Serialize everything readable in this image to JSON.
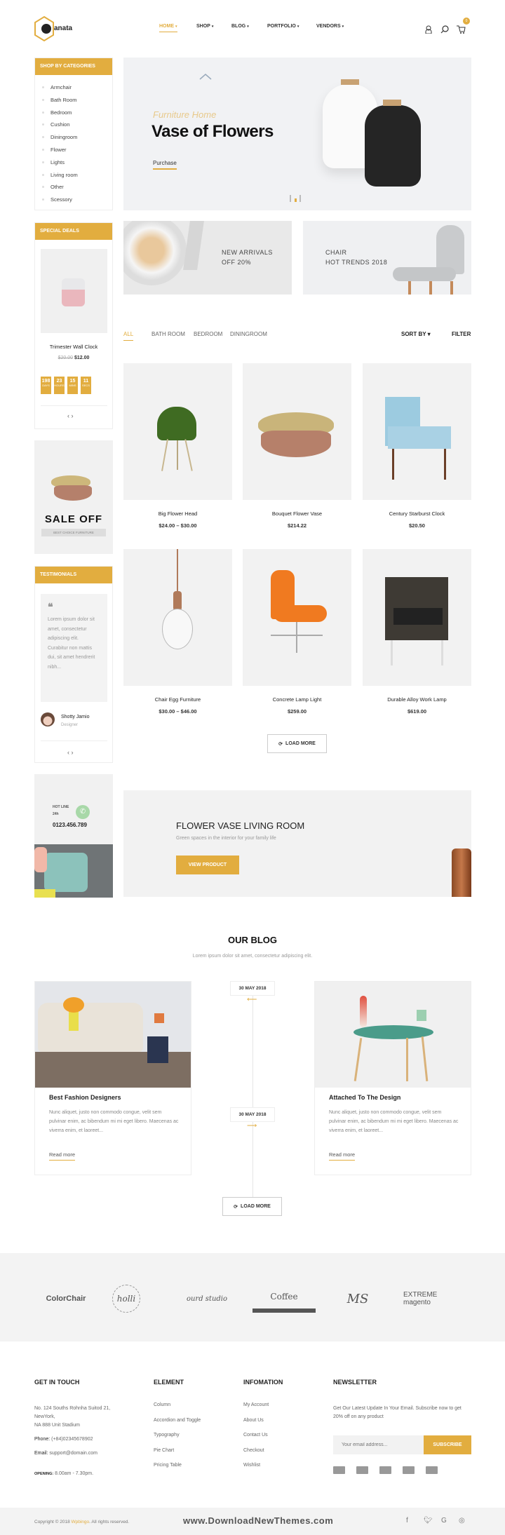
{
  "header": {
    "logo_text": "anata",
    "nav": [
      {
        "label": "HOME",
        "active": true
      },
      {
        "label": "SHOP"
      },
      {
        "label": "BLOG"
      },
      {
        "label": "PORTFOLIO"
      },
      {
        "label": "VENDORS"
      }
    ],
    "cart_count": "0",
    "icons": [
      "user-icon",
      "search-icon",
      "cart-icon"
    ]
  },
  "sidebar": {
    "categories_title": "SHOP BY CATEGORIES",
    "categories": [
      "Armchair",
      "Bath Room",
      "Bedroom",
      "Cushion",
      "Diningroom",
      "Flower",
      "Lights",
      "Living room",
      "Other",
      "Scessory"
    ],
    "special_title": "SPECIAL DEALS",
    "special": {
      "name": "Trimester Wall Clock",
      "old_price": "$20.00",
      "price": "$12.00",
      "countdown": [
        {
          "value": "198",
          "unit": "DAYS"
        },
        {
          "value": "23",
          "unit": "HOURS"
        },
        {
          "value": "15",
          "unit": "MINS"
        },
        {
          "value": "11",
          "unit": "SECS"
        }
      ]
    },
    "sale": {
      "title": "SALE OFF",
      "tag": "BEST CHOICE FURNITURE"
    },
    "testimonials_title": "TESTIMONIALS",
    "testimonial": {
      "text": "Lorem ipsum dolor sit amet, consectetur adipiscing elit. Curabitur non mattis dui, sit amet hendrerit nibh...",
      "name": "Shotty Jamio",
      "role": "Designer"
    },
    "hotline": {
      "label": "HOT LINE 24h",
      "phone": "0123.456.789"
    }
  },
  "hero": {
    "kicker": "Furniture Home",
    "title": "Vase of Flowers",
    "cta": "Purchase",
    "slides": 3,
    "active_slide": 2
  },
  "banners": [
    {
      "line1": "NEW ARRIVALS",
      "line2": "OFF 20%"
    },
    {
      "line1": "CHAIR",
      "line2": "HOT TRENDS 2018"
    }
  ],
  "filter": {
    "tabs": [
      "ALL",
      "BATH ROOM",
      "BEDROOM",
      "DININGROOM"
    ],
    "active_tab": "ALL",
    "sort_label": "SORT BY",
    "filter_label": "FILTER"
  },
  "products": [
    {
      "name": "Big Flower Head",
      "price": "$24.00 – $30.00",
      "image": "green-chair"
    },
    {
      "name": "Bouquet Flower Vase",
      "price": "$214.22",
      "image": "baskets"
    },
    {
      "name": "Century Starburst Clock",
      "price": "$20.50",
      "image": "blue-chair"
    },
    {
      "name": "Chair Egg Furniture",
      "price": "$30.00 – $46.00",
      "image": "bulb-lamp"
    },
    {
      "name": "Concrete Lamp Light",
      "price": "$259.00",
      "image": "orange-chair"
    },
    {
      "name": "Durable Alloy Work Lamp",
      "price": "$619.00",
      "image": "wicker-chair"
    }
  ],
  "load_more": "LOAD MORE",
  "promo": {
    "title": "FLOWER VASE LIVING ROOM",
    "subtitle": "Green spaces in the interior for your family life",
    "cta": "VIEW PRODUCT"
  },
  "blog": {
    "title": "OUR BLOG",
    "subtitle": "Lorem ipsum dolor sit amet, consectetur adipiscing elit.",
    "posts": [
      {
        "title": "Best Fashion Designers",
        "date": "30 MAY 2018",
        "excerpt": "Nunc aliquet, justo non commodo congue, velit sem pulvinar enim, ac bibendum mi mi eget libero. Maecenas ac viverra enim, et laoreet...",
        "read_more": "Read more"
      },
      {
        "title": "Attached To The Design",
        "date": "30 MAY 2018",
        "excerpt": "Nunc aliquet, justo non commodo congue, velit sem pulvinar enim, ac bibendum mi mi eget libero. Maecenas ac viverra enim, et laoreet...",
        "read_more": "Read more"
      }
    ],
    "load_more": "LOAD MORE"
  },
  "brands": [
    "ColorChair",
    "holli",
    "ourd studio",
    "Coffee",
    "MS",
    "EXTREME magento"
  ],
  "footer": {
    "contact": {
      "title": "GET IN TOUCH",
      "address1": "No. 124 Souths Rohnha Suitod 21,",
      "address2": "NewYork,",
      "address3": "NA 888 Unit Stadium",
      "phone_label": "Phone:",
      "phone": "(+84)02345678902",
      "email_label": "Email:",
      "email": "support@domain.com",
      "opening_label": "OPENING:",
      "opening": "8.00am - 7.30pm."
    },
    "element": {
      "title": "ELEMENT",
      "links": [
        "Column",
        "Accordion and Toggle",
        "Typography",
        "Pie Chart",
        "Pricing Table"
      ]
    },
    "info": {
      "title": "INFOMATION",
      "links": [
        "My Account",
        "About Us",
        "Contact Us",
        "Checkout",
        "Wishlist"
      ]
    },
    "newsletter": {
      "title": "NEWSLETTER",
      "text1": "Get Our Latest Update In Your Email. Subscribe now to get",
      "text2": "20% off on any product",
      "placeholder": "Your email address...",
      "button": "SUBSCRIBE",
      "payments": [
        "visa-icon",
        "diners-icon",
        "paypal-icon",
        "mastercard-icon",
        "amex-icon"
      ]
    },
    "copyright_pre": "Copyright © 2018",
    "copyright_brand": "Wpbingo",
    "copyright_post": ". All rights reserved.",
    "watermark": "www.DownloadNewThemes.com",
    "social": [
      "facebook-icon",
      "twitter-icon",
      "google-icon",
      "instagram-icon"
    ]
  },
  "colors": {
    "accent": "#e2ad3f",
    "panel": "#f2f2f2"
  }
}
